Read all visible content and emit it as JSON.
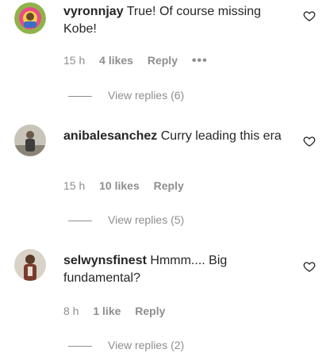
{
  "comments": [
    {
      "username": "vyronnjay",
      "text": "True! Of course missing Kobe!",
      "time": "15 h",
      "likes": "4 likes",
      "reply": "Reply",
      "more": "•••",
      "view_replies": "View replies (6)",
      "avatar_icon": "user-avatar"
    },
    {
      "username": "anibalesanchez",
      "text": "Curry leading this era",
      "time": "15 h",
      "likes": "10 likes",
      "reply": "Reply",
      "view_replies": "View replies (5)",
      "avatar_icon": "user-avatar"
    },
    {
      "username": "selwynsfinest",
      "text": "Hmmm.... Big fundamental?",
      "time": "8 h",
      "likes": "1 like",
      "reply": "Reply",
      "view_replies": "View replies (2)",
      "avatar_icon": "user-avatar"
    }
  ],
  "icons": {
    "like": "heart-icon",
    "more": "more-options-icon"
  }
}
